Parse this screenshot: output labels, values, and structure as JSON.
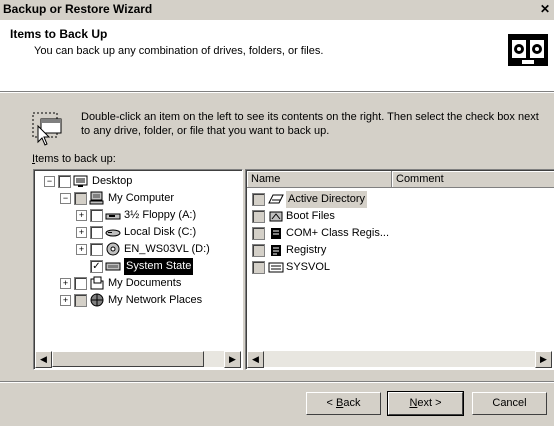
{
  "window": {
    "title": "Backup or Restore Wizard",
    "close_glyph": "✕"
  },
  "header": {
    "title": "Items to Back Up",
    "subtitle": "You can back up any combination of drives, folders, or files."
  },
  "info": {
    "text": "Double-click an item on the left to see its contents on the right. Then select the check box next to any drive, folder, or file that you want to back up."
  },
  "items_label": {
    "accel": "I",
    "rest": "tems to back up:"
  },
  "tree": [
    {
      "label": "Desktop",
      "icon": "desktop-icon",
      "checked": false,
      "grey": false,
      "expander": "−"
    },
    {
      "label": "My Computer",
      "icon": "computer-icon",
      "checked": false,
      "grey": true,
      "expander": "−"
    },
    {
      "label": "3½ Floppy (A:)",
      "icon": "floppy-icon",
      "checked": false,
      "grey": false,
      "expander": "+"
    },
    {
      "label": "Local Disk (C:)",
      "icon": "disk-icon",
      "checked": false,
      "grey": false,
      "expander": "+"
    },
    {
      "label": "EN_WS03VL (D:)",
      "icon": "cdrom-icon",
      "checked": false,
      "grey": false,
      "expander": "+"
    },
    {
      "label": "System State",
      "icon": "system-state-icon",
      "checked": true,
      "grey": false,
      "expander": "",
      "selected": true
    },
    {
      "label": "My Documents",
      "icon": "documents-icon",
      "checked": false,
      "grey": false,
      "expander": "+"
    },
    {
      "label": "My Network Places",
      "icon": "network-icon",
      "checked": false,
      "grey": true,
      "expander": "+"
    }
  ],
  "list": {
    "columns": [
      "Name",
      "Comment"
    ],
    "items": [
      {
        "label": "Active Directory",
        "icon": "active-directory-icon",
        "highlight": true
      },
      {
        "label": "Boot Files",
        "icon": "boot-files-icon"
      },
      {
        "label": "COM+ Class Regis...",
        "icon": "com-class-icon"
      },
      {
        "label": "Registry",
        "icon": "registry-icon"
      },
      {
        "label": "SYSVOL",
        "icon": "sysvol-icon"
      }
    ]
  },
  "buttons": {
    "back": {
      "accel": "B",
      "pre": "< ",
      "post": "ack"
    },
    "next": {
      "accel": "N",
      "post": "ext >"
    },
    "cancel": "Cancel"
  },
  "colors": {
    "face": "#d4d0c8",
    "shadow": "#808080",
    "selection": "#000000"
  }
}
